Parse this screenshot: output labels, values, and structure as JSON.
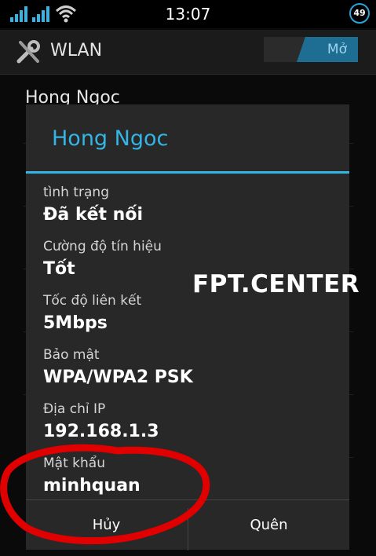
{
  "status_bar": {
    "time": "13:07",
    "battery": "49",
    "icons": [
      "signal-bars-icon",
      "signal-bars-icon",
      "wifi-icon",
      "battery-circle-icon"
    ]
  },
  "action_bar": {
    "icon": "wrench-icon",
    "title": "WLAN",
    "toggle_label": "Mở"
  },
  "background_list": {
    "first_item": "Hong Ngoc"
  },
  "dialog": {
    "title": "Hong Ngoc",
    "fields": [
      {
        "label": "tình trạng",
        "value": "Đã kết nối"
      },
      {
        "label": "Cường độ tín hiệu",
        "value": "Tốt"
      },
      {
        "label": "Tốc độ liên kết",
        "value": "5Mbps"
      },
      {
        "label": "Bảo mật",
        "value": "WPA/WPA2 PSK"
      },
      {
        "label": "Địa chỉ IP",
        "value": "192.168.1.3"
      },
      {
        "label": "Mật khẩu",
        "value": "minhquan"
      }
    ],
    "buttons": {
      "cancel": "Hủy",
      "forget": "Quên"
    }
  },
  "watermark": "FPT.CENTER",
  "colors": {
    "accent": "#33b5e5",
    "dialog_bg": "#282828",
    "annotation": "#e00000"
  }
}
